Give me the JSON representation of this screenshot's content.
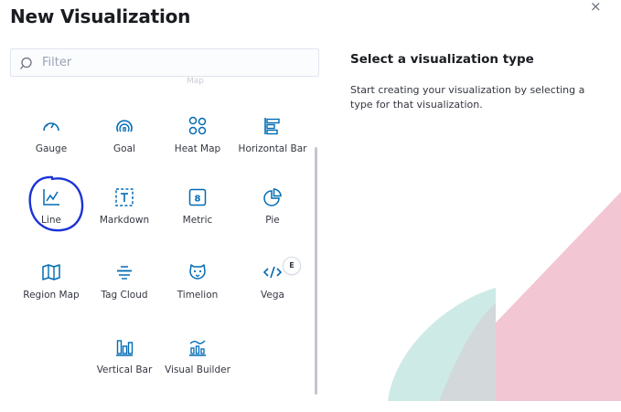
{
  "header": {
    "title": "New Visualization",
    "close_symbol": "×"
  },
  "filter": {
    "placeholder": "Filter",
    "value": ""
  },
  "partial_label": "Map",
  "tiles": [
    {
      "label": "Gauge",
      "icon": "gauge-icon"
    },
    {
      "label": "Goal",
      "icon": "goal-icon"
    },
    {
      "label": "Heat Map",
      "icon": "heat-map-icon"
    },
    {
      "label": "Horizontal Bar",
      "icon": "horizontal-bar-icon"
    },
    {
      "label": "Line",
      "icon": "line-chart-icon",
      "highlighted": true
    },
    {
      "label": "Markdown",
      "icon": "markdown-icon"
    },
    {
      "label": "Metric",
      "icon": "metric-icon"
    },
    {
      "label": "Pie",
      "icon": "pie-icon"
    },
    {
      "label": "Region Map",
      "icon": "region-map-icon"
    },
    {
      "label": "Tag Cloud",
      "icon": "tag-cloud-icon"
    },
    {
      "label": "Timelion",
      "icon": "timelion-icon"
    },
    {
      "label": "Vega",
      "icon": "vega-icon",
      "badge": "E"
    },
    {
      "label": "Vertical Bar",
      "icon": "vertical-bar-icon"
    },
    {
      "label": "Visual Builder",
      "icon": "visual-builder-icon"
    }
  ],
  "info": {
    "title": "Select a visualization type",
    "description": "Start creating your visualization by selecting a type for that visualization."
  },
  "colors": {
    "icon": "#006bb4",
    "annotation": "#1a33d6",
    "art_pink": "#f3c6d3",
    "art_teal": "#cdeae6"
  }
}
